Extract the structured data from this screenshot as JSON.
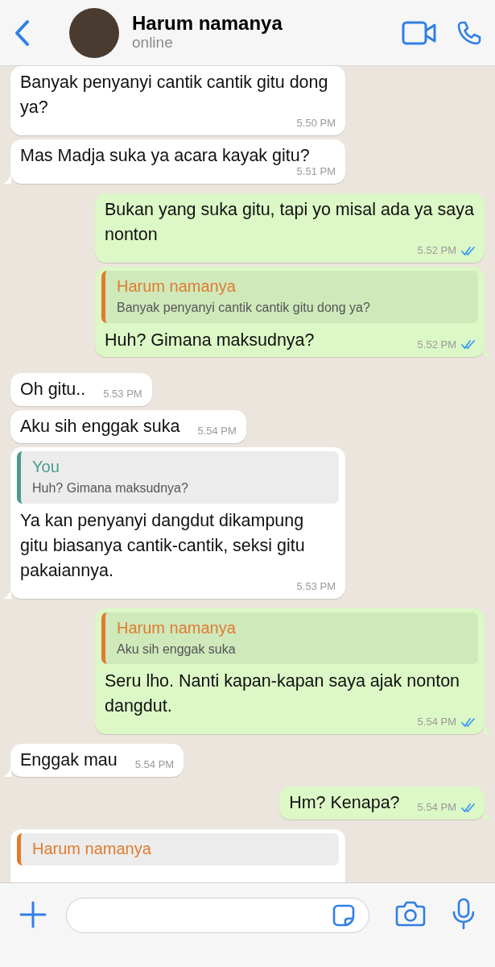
{
  "header": {
    "contact": "Harum namanya",
    "status": "online"
  },
  "messages": [
    {
      "kind": "in",
      "text": "Banyak penyanyi cantik cantik gitu dong ya?",
      "time": "5.50 PM",
      "tail": false
    },
    {
      "kind": "in",
      "text": "Mas Madja suka ya acara kayak gitu?",
      "time": "5.51 PM",
      "tail": true
    },
    {
      "kind": "out",
      "text": "Bukan yang suka gitu, tapi yo misal ada ya saya nonton",
      "time": "5.52 PM",
      "read": true,
      "tail": false
    },
    {
      "kind": "out",
      "quote": {
        "author": "Harum namanya",
        "text": "Banyak penyanyi cantik cantik gitu dong ya?",
        "color": "#e07b2e"
      },
      "text": "Huh? Gimana maksudnya?",
      "time": "5.52 PM",
      "read": true,
      "tail": true
    },
    {
      "kind": "in",
      "text": "Oh gitu..",
      "time": "5.53 PM",
      "tail": false
    },
    {
      "kind": "in",
      "text": "Aku sih enggak suka",
      "time": "5.54 PM",
      "tail": false
    },
    {
      "kind": "in",
      "quote": {
        "author": "You",
        "text": "Huh? Gimana maksudnya?",
        "color": "#4a9b8e"
      },
      "text": "Ya kan penyanyi dangdut dikampung gitu biasanya cantik-cantik, seksi gitu pakaiannya.",
      "time": "5.53 PM",
      "tail": true
    },
    {
      "kind": "out",
      "quote": {
        "author": "Harum namanya",
        "text": "Aku sih enggak suka",
        "color": "#e07b2e"
      },
      "text": "Seru lho. Nanti kapan-kapan saya ajak nonton dangdut.",
      "time": "5.54 PM",
      "read": true,
      "tail": true
    },
    {
      "kind": "in",
      "text": "Enggak mau",
      "time": "5.54 PM",
      "tail": true
    },
    {
      "kind": "out",
      "text": "Hm? Kenapa?",
      "time": "5.54 PM",
      "read": true,
      "tail": true
    },
    {
      "kind": "in",
      "quote": {
        "author": "Harum namanya",
        "color": "#e07b2e"
      },
      "tail": false
    }
  ]
}
